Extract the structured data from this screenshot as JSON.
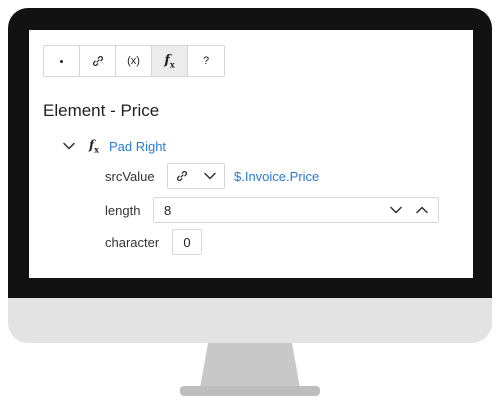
{
  "toolbar": {
    "buttons": [
      {
        "icon": "dot-icon",
        "label": ""
      },
      {
        "icon": "link-icon",
        "label": ""
      },
      {
        "icon": "variable-icon",
        "label": "(x)"
      },
      {
        "icon": "function-icon",
        "label": "f"
      },
      {
        "icon": "help-icon",
        "label": "?"
      }
    ],
    "active_index": 3
  },
  "element": {
    "title": "Element - Price"
  },
  "function": {
    "name": "Pad Right",
    "fx_symbol": "f",
    "fx_sub": "x",
    "expanded": true,
    "params": {
      "srcValue": {
        "label": "srcValue",
        "value": "$.Invoice.Price",
        "mode_icon": "link-icon"
      },
      "length": {
        "label": "length",
        "value": "8"
      },
      "character": {
        "label": "character",
        "value": "0"
      }
    }
  },
  "colors": {
    "link": "#2a7bd6",
    "bezel": "#121212",
    "active_button": "#ececec"
  }
}
